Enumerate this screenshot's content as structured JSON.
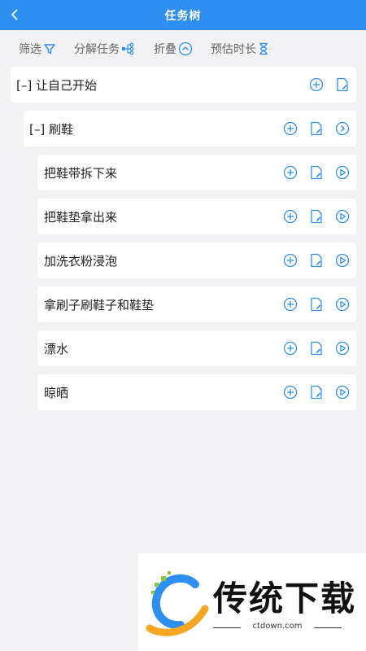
{
  "header": {
    "title": "任务树"
  },
  "toolbar": {
    "filter_label": "筛选",
    "split_label": "分解任务",
    "fold_label": "折叠",
    "estimate_label": "预估时长"
  },
  "tree": {
    "root": {
      "label": "[–] 让自己开始"
    },
    "group": {
      "label": "[–] 刷鞋"
    },
    "tasks": [
      "把鞋带拆下来",
      "把鞋垫拿出来",
      "加洗衣粉浸泡",
      "拿刷子刷鞋子和鞋垫",
      "漂水",
      "晾晒"
    ]
  },
  "colors": {
    "primary": "#2e8ff0",
    "background": "#f2f2f4"
  },
  "watermark": {
    "brand": "传统下载",
    "url": "ctdown.com"
  }
}
